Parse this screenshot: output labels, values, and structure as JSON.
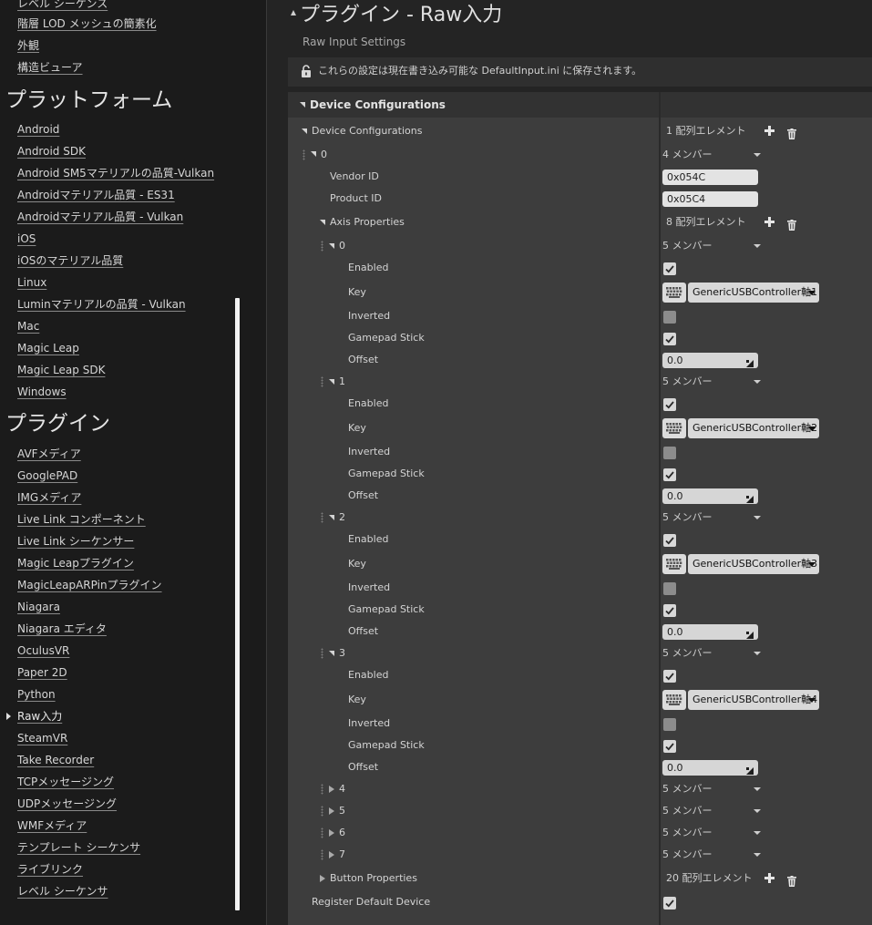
{
  "sidebar": {
    "top_items": [
      "レベル シーケンス",
      "階層 LOD メッシュの簡素化",
      "外観",
      "構造ビューア"
    ],
    "platform_header": "プラットフォーム",
    "platform_items": [
      "Android",
      "Android SDK",
      "Android SM5マテリアルの品質-Vulkan",
      "Androidマテリアル品質 - ES31",
      "Androidマテリアル品質 - Vulkan",
      "iOS",
      "iOSのマテリアル品質",
      "Linux",
      "Luminマテリアルの品質 - Vulkan",
      "Mac",
      "Magic Leap",
      "Magic Leap SDK",
      "Windows"
    ],
    "plugin_header": "プラグイン",
    "plugin_items": [
      "AVFメディア",
      "GooglePAD",
      "IMGメディア",
      "Live Link コンポーネント",
      "Live Link シーケンサー",
      "Magic Leapプラグイン",
      "MagicLeapARPinプラグイン",
      "Niagara",
      "Niagara エディタ",
      "OculusVR",
      "Paper 2D",
      "Python",
      "Raw入力",
      "SteamVR",
      "Take Recorder",
      "TCPメッセージング",
      "UDPメッセージング",
      "WMFメディア",
      "テンプレート シーケンサ",
      "ライブリンク",
      "レベル シーケンサ"
    ],
    "active_item": "Raw入力"
  },
  "page": {
    "title": "プラグイン - Raw入力",
    "subtitle": "Raw Input Settings",
    "notice": "これらの設定は現在書き込み可能な DefaultInput.ini に保存されます。"
  },
  "props": {
    "section_header": "Device Configurations",
    "device_configurations_label": "Device Configurations",
    "device_configurations_count": "1 配列エレメント",
    "device_index": "0",
    "device_members": "4 メンバー",
    "vendor_id_label": "Vendor ID",
    "vendor_id": "0x054C",
    "product_id_label": "Product ID",
    "product_id": "0x05C4",
    "axis_properties_label": "Axis Properties",
    "axis_properties_count": "8 配列エレメント",
    "axes": [
      {
        "index": "0",
        "members": "5 メンバー",
        "enabled": true,
        "key": "GenericUSBController軸1",
        "inverted": false,
        "gamepad_stick": true,
        "offset": "0.0"
      },
      {
        "index": "1",
        "members": "5 メンバー",
        "enabled": true,
        "key": "GenericUSBController軸2",
        "inverted": false,
        "gamepad_stick": true,
        "offset": "0.0"
      },
      {
        "index": "2",
        "members": "5 メンバー",
        "enabled": true,
        "key": "GenericUSBController軸3",
        "inverted": false,
        "gamepad_stick": true,
        "offset": "0.0"
      },
      {
        "index": "3",
        "members": "5 メンバー",
        "enabled": true,
        "key": "GenericUSBController軸4",
        "inverted": false,
        "gamepad_stick": true,
        "offset": "0.0"
      }
    ],
    "field_labels": {
      "enabled": "Enabled",
      "key": "Key",
      "inverted": "Inverted",
      "gamepad_stick": "Gamepad Stick",
      "offset": "Offset"
    },
    "collapsed_axes": [
      {
        "index": "4",
        "members": "5 メンバー"
      },
      {
        "index": "5",
        "members": "5 メンバー"
      },
      {
        "index": "6",
        "members": "5 メンバー"
      },
      {
        "index": "7",
        "members": "5 メンバー"
      }
    ],
    "button_properties_label": "Button Properties",
    "button_properties_count": "20 配列エレメント",
    "register_default_device_label": "Register Default Device",
    "register_default_device": true
  },
  "colors": {
    "panel": "#3d3d3d",
    "header": "#323232",
    "background": "#242424",
    "sidebar": "#1b1b1b"
  },
  "icons": {
    "add": "plus-icon",
    "delete": "trash-icon",
    "lock": "lock-icon",
    "key_select": "keyboard-icon"
  }
}
